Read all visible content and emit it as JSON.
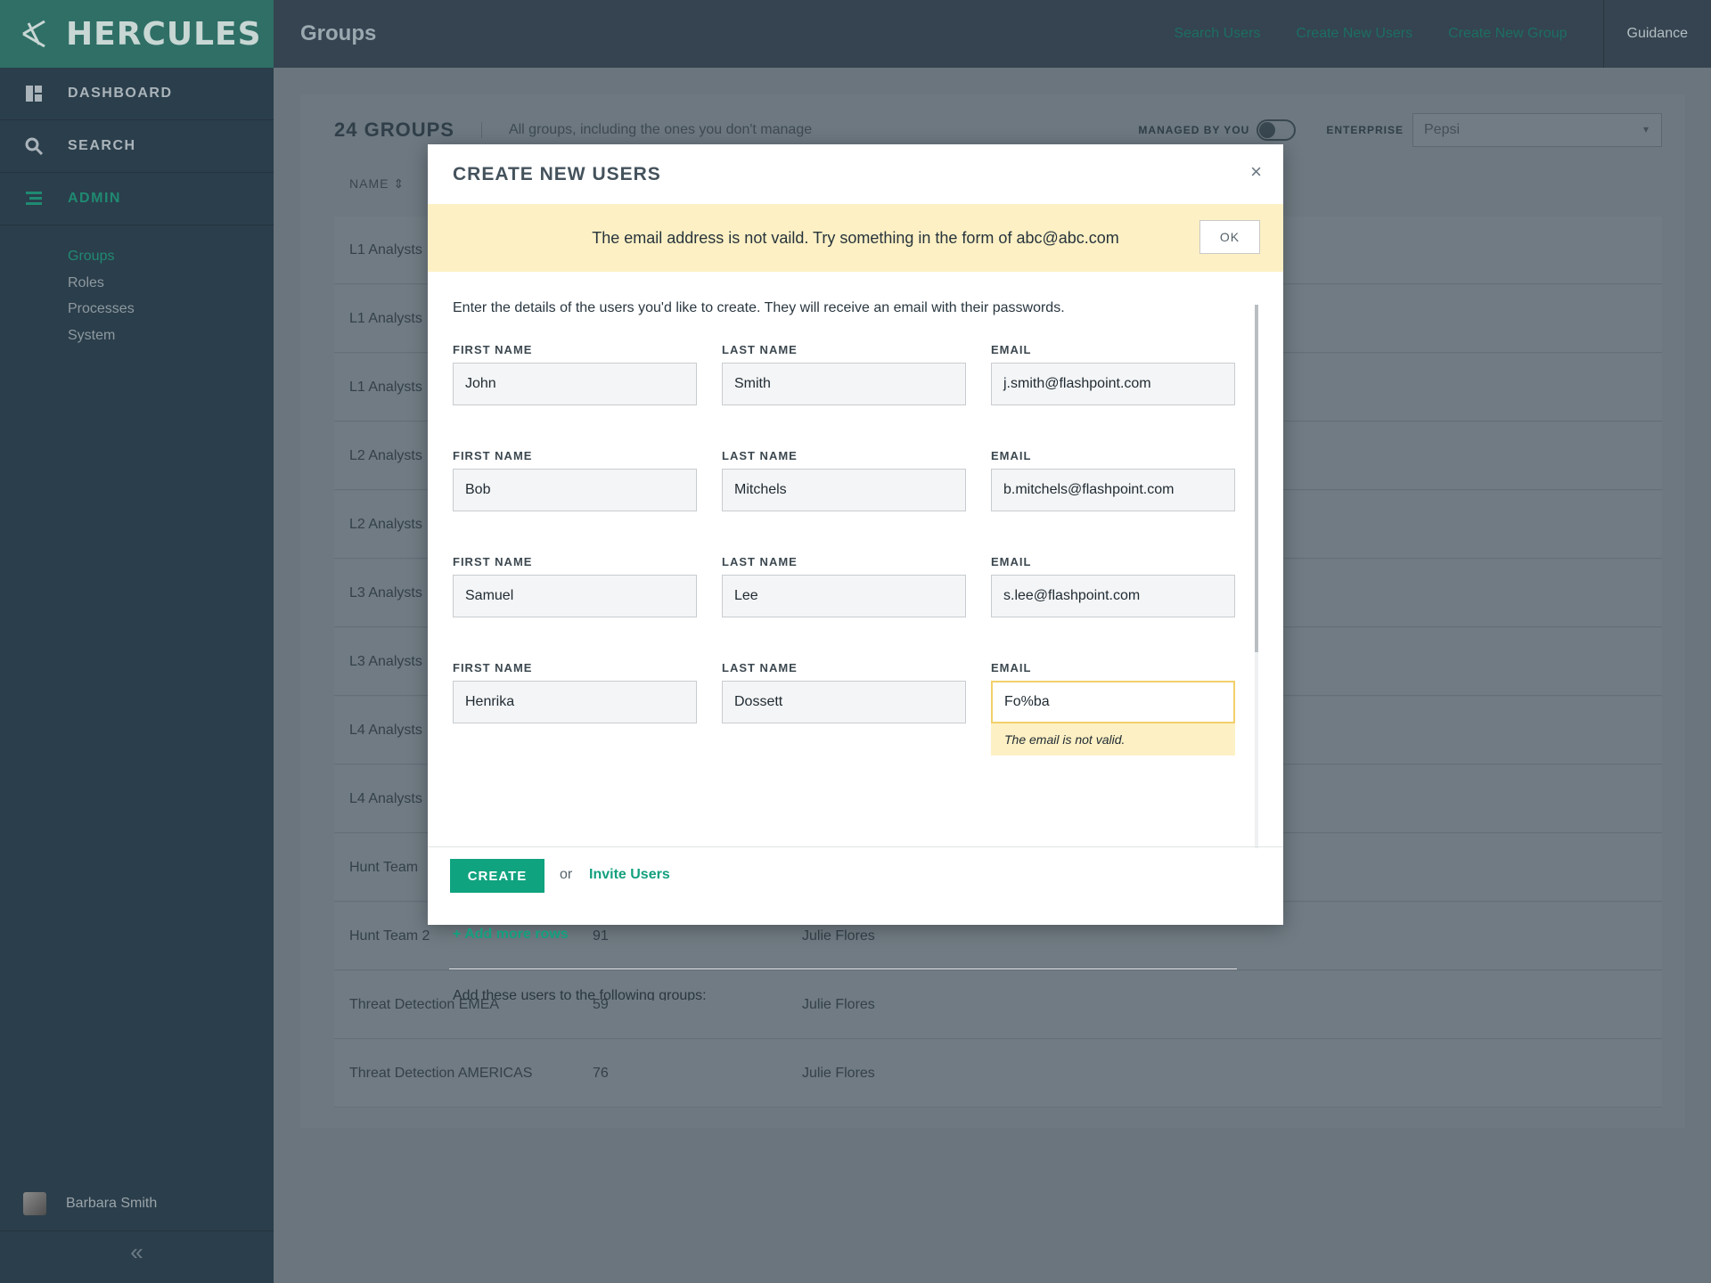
{
  "app": {
    "name": "HERCULES",
    "page_title": "Groups"
  },
  "nav": {
    "items": [
      {
        "label": "DASHBOARD",
        "icon": "dashboard-icon"
      },
      {
        "label": "SEARCH",
        "icon": "search-icon"
      },
      {
        "label": "ADMIN",
        "icon": "admin-icon"
      }
    ],
    "subitems": [
      "Groups",
      "Roles",
      "Processes",
      "System"
    ],
    "user": "Barbara Smith",
    "collapse": "«"
  },
  "topbar": {
    "links": [
      "Search Users",
      "Create New Users",
      "Create New Group"
    ],
    "guidance": "Guidance"
  },
  "panel": {
    "count": "24 GROUPS",
    "description": "All groups, including the ones you don't manage",
    "managed_label": "MANAGED BY YOU",
    "enterprise_label": "ENTERPRISE",
    "enterprise_value": "Pepsi",
    "name_col": "NAME"
  },
  "table": {
    "rows": [
      {
        "name": "L1 Analysts",
        "count": "",
        "owner": ""
      },
      {
        "name": "L1 Analysts",
        "count": "",
        "owner": ""
      },
      {
        "name": "L1 Analysts",
        "count": "",
        "owner": ""
      },
      {
        "name": "L2 Analysts",
        "count": "",
        "owner": ""
      },
      {
        "name": "L2 Analysts",
        "count": "",
        "owner": ""
      },
      {
        "name": "L3 Analysts",
        "count": "",
        "owner": ""
      },
      {
        "name": "L3 Analysts",
        "count": "",
        "owner": ""
      },
      {
        "name": "L4 Analysts",
        "count": "",
        "owner": ""
      },
      {
        "name": "L4 Analysts",
        "count": "",
        "owner": ""
      },
      {
        "name": "Hunt Team",
        "count": "",
        "owner": ""
      },
      {
        "name": "Hunt Team 2",
        "count": "91",
        "owner": "Julie Flores"
      },
      {
        "name": "Threat Detection EMEA",
        "count": "59",
        "owner": "Julie Flores"
      },
      {
        "name": "Threat Detection AMERICAS",
        "count": "76",
        "owner": "Julie Flores"
      }
    ]
  },
  "modal": {
    "title": "CREATE NEW USERS",
    "close": "×",
    "alert": "The email address is not vaild. Try something in the form of abc@abc.com",
    "ok": "OK",
    "intro": "Enter the details of the users you'd like to create. They will receive an email with their passwords.",
    "labels": {
      "first": "FIRST NAME",
      "last": "LAST NAME",
      "email": "EMAIL"
    },
    "users": [
      {
        "first": "John",
        "last": "Smith",
        "email": "j.smith@flashpoint.com"
      },
      {
        "first": "Bob",
        "last": "Mitchels",
        "email": "b.mitchels@flashpoint.com"
      },
      {
        "first": "Samuel",
        "last": "Lee",
        "email": "s.lee@flashpoint.com"
      },
      {
        "first": "Henrika",
        "last": "Dossett",
        "email": "Fo%ba"
      }
    ],
    "email_error": "The email is not valid.",
    "add_rows": "+ Add more rows",
    "groups_prompt": "Add these users to the following groups:",
    "create": "CREATE",
    "or": "or",
    "invite": "Invite Users"
  }
}
